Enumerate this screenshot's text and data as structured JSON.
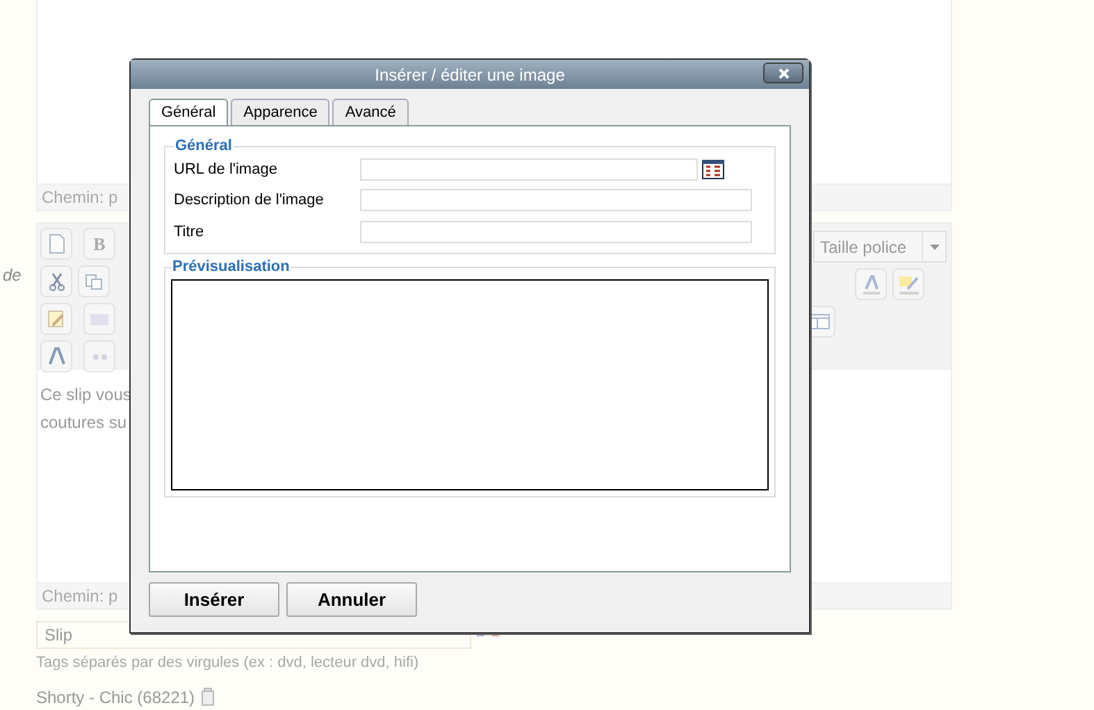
{
  "editor_top": {
    "path_label": "Chemin: p"
  },
  "field_label": "de",
  "editor": {
    "bold_key": "B",
    "font_size_select": "Taille police",
    "content_lines": [
      "Ce slip vous",
      "coutures su"
    ],
    "path_label": "Chemin: p"
  },
  "tags_field": {
    "value": "Slip",
    "hint": "Tags séparés par des virgules (ex : dvd, lecteur dvd, hifi)"
  },
  "product": {
    "label": "Shorty - Chic (68221)"
  },
  "dialog": {
    "title": "Insérer / éditer une image",
    "tabs": [
      {
        "label": "Général",
        "selected": true
      },
      {
        "label": "Apparence",
        "selected": false
      },
      {
        "label": "Avancé",
        "selected": false
      }
    ],
    "general_legend": "Général",
    "fields": [
      {
        "label": "URL de l'image",
        "browse": true
      },
      {
        "label": "Description de l'image",
        "browse": false
      },
      {
        "label": "Titre",
        "browse": false
      }
    ],
    "preview_legend": "Prévisualisation",
    "buttons": [
      "Insérer",
      "Annuler"
    ]
  }
}
